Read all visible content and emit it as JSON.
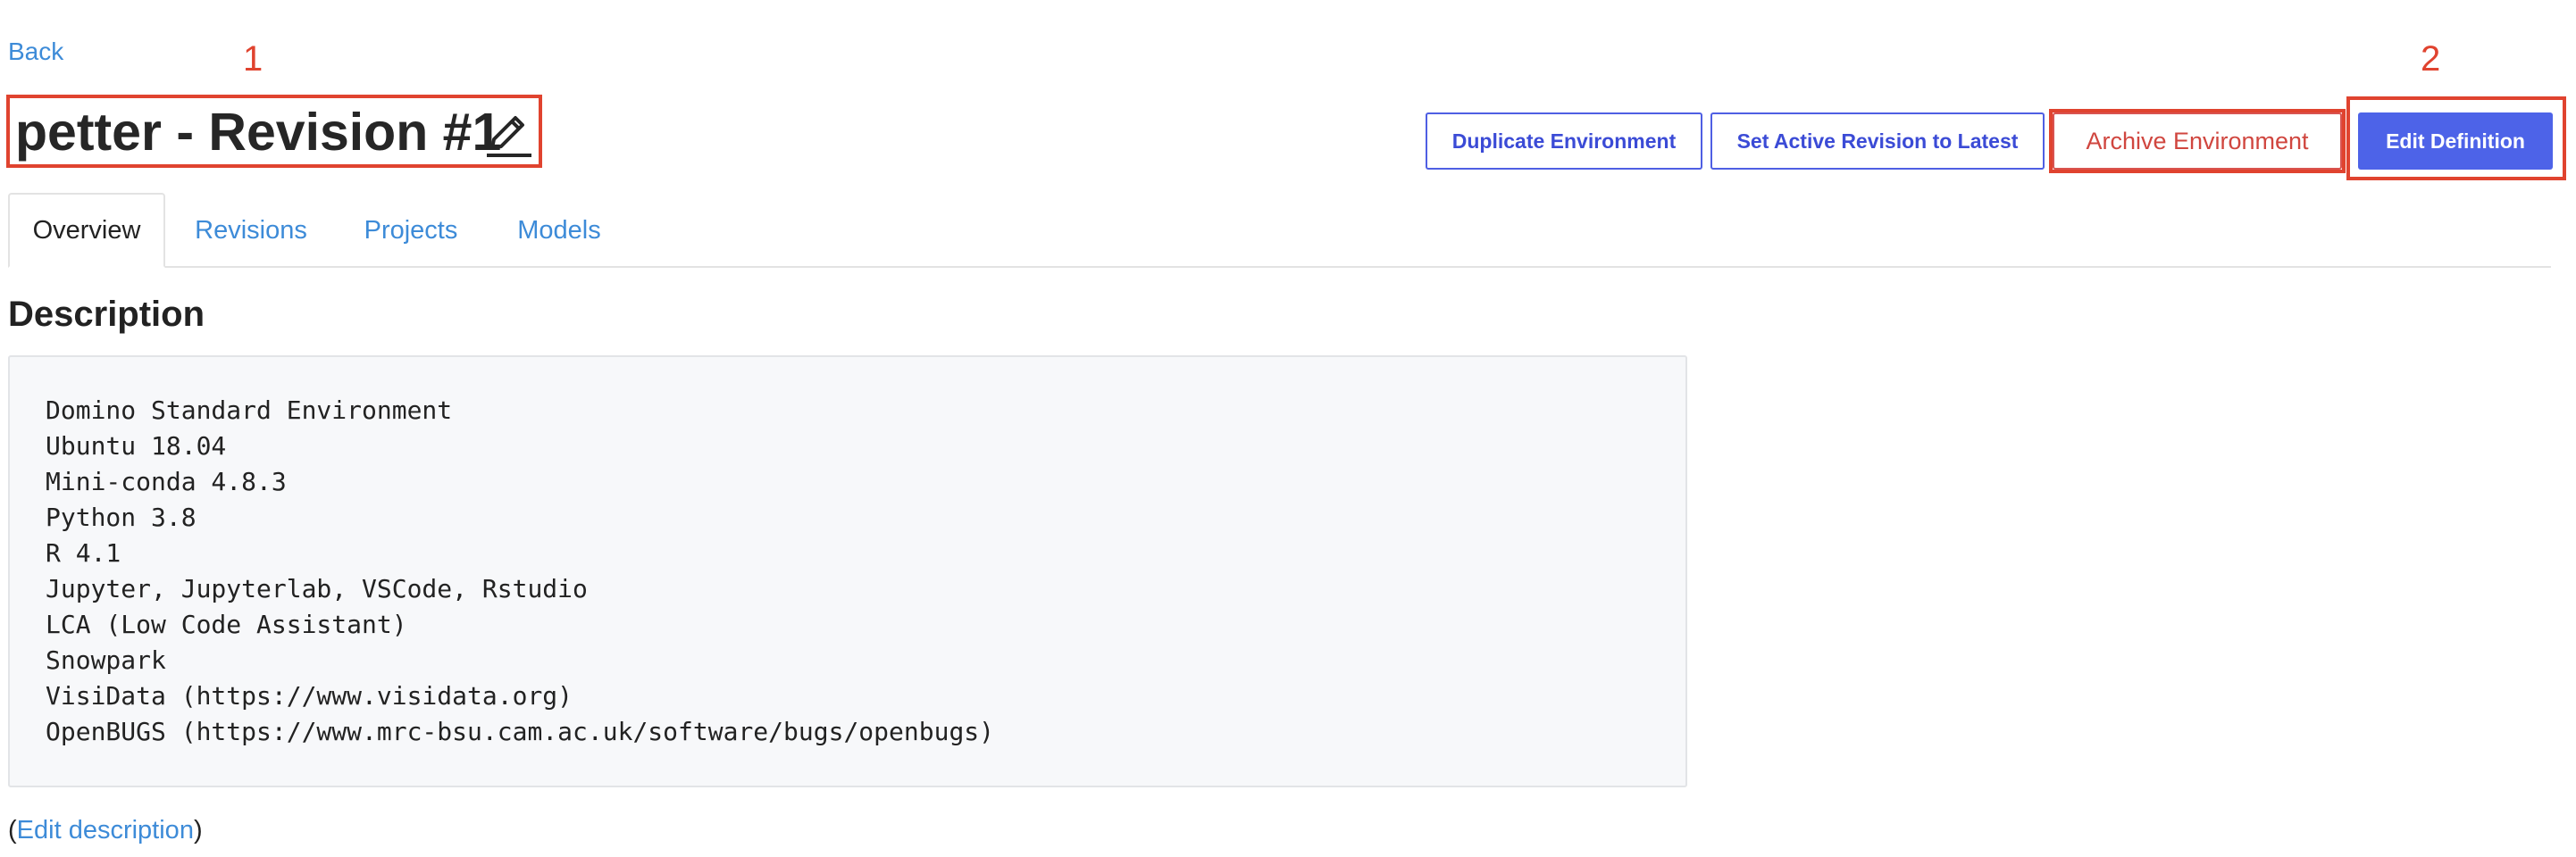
{
  "nav": {
    "back_label": "Back"
  },
  "annotations": {
    "title_marker": "1",
    "edit_marker": "2",
    "color": "#e0432f"
  },
  "header": {
    "title": "petter - Revision #1",
    "edit_title_icon": "pencil-icon"
  },
  "actions": {
    "duplicate": "Duplicate Environment",
    "set_active": "Set Active Revision to Latest",
    "archive": "Archive Environment",
    "edit_definition": "Edit Definition"
  },
  "tabs": [
    {
      "label": "Overview",
      "active": true
    },
    {
      "label": "Revisions",
      "active": false
    },
    {
      "label": "Projects",
      "active": false
    },
    {
      "label": "Models",
      "active": false
    }
  ],
  "description": {
    "heading": "Description",
    "lines": [
      "Domino Standard Environment",
      "Ubuntu 18.04",
      "Mini-conda 4.8.3",
      "Python 3.8",
      "R 4.1",
      "Jupyter, Jupyterlab, VSCode, Rstudio",
      "LCA (Low Code Assistant)",
      "Snowpark",
      "VisiData (https://www.visidata.org)",
      "OpenBUGS (https://www.mrc-bsu.cam.ac.uk/software/bugs/openbugs)"
    ],
    "edit_open": "(",
    "edit_link": "Edit description",
    "edit_close": ")"
  },
  "colors": {
    "link": "#3d8bd8",
    "primary": "#4d63e8",
    "danger": "#d0463f",
    "annotation_red": "#e0432f"
  }
}
